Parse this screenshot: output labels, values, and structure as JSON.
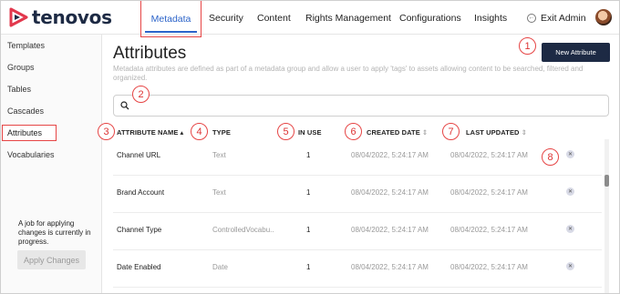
{
  "brand": {
    "name": "tenovos",
    "accent": "#e2384d"
  },
  "nav": {
    "metadata": "Metadata",
    "security": "Security",
    "content": "Content",
    "rights": "Rights Management",
    "configurations": "Configurations",
    "insights": "Insights",
    "exit_admin": "Exit Admin"
  },
  "sidebar": {
    "items": [
      "Templates",
      "Groups",
      "Tables",
      "Cascades",
      "Attributes",
      "Vocabularies"
    ],
    "active": "Attributes",
    "job_note": "A job for applying changes is currently in progress.",
    "apply_button": "Apply Changes"
  },
  "page": {
    "title": "Attributes",
    "subtitle": "Metadata attributes are defined as part of a metadata group and allow a user to apply 'tags' to assets allowing content to be searched, filtered and organized.",
    "new_button": "New Attribute",
    "search_placeholder": ""
  },
  "table": {
    "headers": {
      "name": "ATTRIBUTE NAME",
      "type": "TYPE",
      "in_use": "IN USE",
      "created": "CREATED DATE",
      "updated": "LAST UPDATED"
    },
    "rows": [
      {
        "name": "Channel URL",
        "type": "Text",
        "in_use": "1",
        "created": "08/04/2022, 5:24:17 AM",
        "updated": "08/04/2022, 5:24:17 AM"
      },
      {
        "name": "Brand Account",
        "type": "Text",
        "in_use": "1",
        "created": "08/04/2022, 5:24:17 AM",
        "updated": "08/04/2022, 5:24:17 AM"
      },
      {
        "name": "Channel Type",
        "type": "ControlledVocabu...",
        "in_use": "1",
        "created": "08/04/2022, 5:24:17 AM",
        "updated": "08/04/2022, 5:24:17 AM"
      },
      {
        "name": "Date Enabled",
        "type": "Date",
        "in_use": "1",
        "created": "08/04/2022, 5:24:17 AM",
        "updated": "08/04/2022, 5:24:17 AM"
      }
    ]
  },
  "callouts": [
    "1",
    "2",
    "3",
    "4",
    "5",
    "6",
    "7",
    "8"
  ],
  "icons": {
    "exit": "exit-arrow-icon",
    "search": "search-icon",
    "delete": "close-circle-icon",
    "sort": "sort-arrows-icon"
  },
  "colors": {
    "primary_button": "#1d2a44",
    "link_active": "#2b63c9",
    "highlight": "#e64545"
  }
}
